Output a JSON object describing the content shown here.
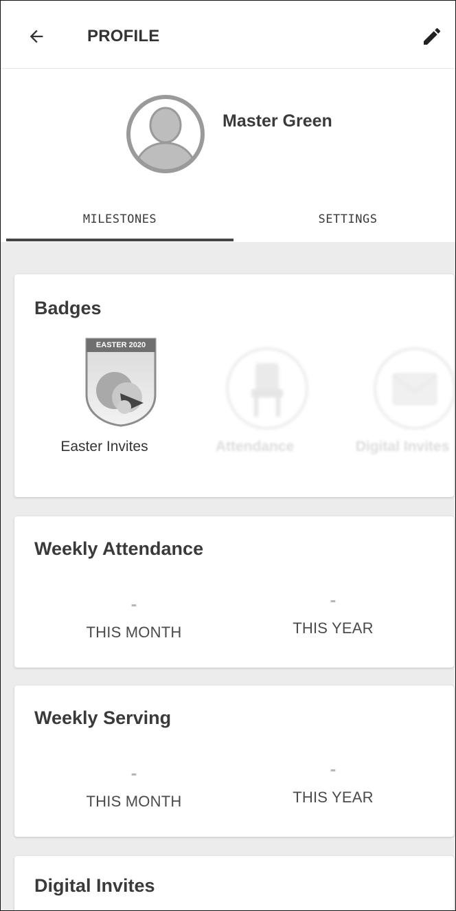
{
  "header": {
    "title": "PROFILE",
    "back_icon": "arrow-left-icon",
    "edit_icon": "pencil-icon"
  },
  "profile": {
    "name": "Master Green",
    "avatar_icon": "user-avatar-icon"
  },
  "tabs": [
    {
      "label": "MILESTONES",
      "selected": true
    },
    {
      "label": "SETTINGS",
      "selected": false
    }
  ],
  "badges": {
    "title": "Badges",
    "items": [
      {
        "label": "Easter Invites",
        "banner": "EASTER 2020",
        "earned": true,
        "icon": "easter-badge-icon"
      },
      {
        "label": "Attendance",
        "earned": false,
        "icon": "chair-badge-icon"
      },
      {
        "label": "Digital Invites",
        "earned": false,
        "icon": "envelope-badge-icon"
      }
    ]
  },
  "weekly_attendance": {
    "title": "Weekly Attendance",
    "month_value": "-",
    "month_label": "THIS MONTH",
    "year_value": "-",
    "year_label": "THIS YEAR"
  },
  "weekly_serving": {
    "title": "Weekly Serving",
    "month_value": "-",
    "month_label": "THIS MONTH",
    "year_value": "-",
    "year_label": "THIS YEAR"
  },
  "digital_invites": {
    "title": "Digital Invites"
  },
  "colors": {
    "background": "#ececec",
    "card": "#ffffff",
    "text": "#333333",
    "muted": "#b7b7b7",
    "tab_indicator": "#454545"
  }
}
